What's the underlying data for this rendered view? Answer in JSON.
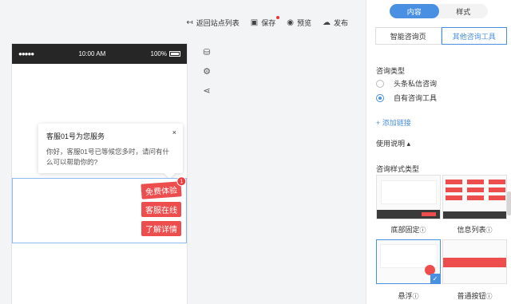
{
  "toolbar": {
    "back_label": "返回站点列表",
    "save_label": "保存",
    "preview_label": "预览",
    "publish_label": "发布"
  },
  "phone": {
    "status_signal": "●●●●●",
    "status_time": "10:00 AM",
    "status_battery": "100%"
  },
  "popup": {
    "title": "客服01号为您服务",
    "text": "你好，客服01号已等候您多时，请问有什么可以帮助你的?",
    "close": "×"
  },
  "float_buttons": [
    {
      "label": "免费体验",
      "badge": "1"
    },
    {
      "label": "客服在线"
    },
    {
      "label": "了解详情"
    }
  ],
  "panel": {
    "seg_tabs": [
      "内容",
      "样式"
    ],
    "tabs": [
      "智能咨询页",
      "其他咨询工具"
    ],
    "consult_type_label": "咨询类型",
    "radio_options": [
      "头条私信咨询",
      "自有咨询工具"
    ],
    "add_link": "+ 添加链接",
    "usage": "使用说明 ▴",
    "style_type_label": "咨询样式类型",
    "styles": [
      {
        "caption": "底部固定"
      },
      {
        "caption": "信息列表"
      },
      {
        "caption": "悬浮"
      },
      {
        "caption": "普通按钮"
      }
    ]
  },
  "icons": {
    "back": "back-arrow-icon",
    "save": "save-icon",
    "preview": "eye-icon",
    "publish": "cloud-upload-icon"
  },
  "colors": {
    "accent": "#4a90e2",
    "red": "#ee4d4d"
  }
}
